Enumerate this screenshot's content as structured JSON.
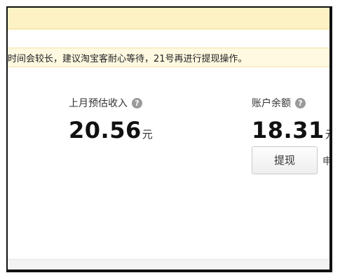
{
  "notice": {
    "text": "时间会较长，建议淘宝客耐心等待，21号再进行提现操作。"
  },
  "stats": {
    "last_month": {
      "label": "上月预估收入",
      "value": "20.56",
      "unit": "元",
      "help_icon": "question-circle-icon"
    },
    "balance": {
      "label": "账户余额",
      "value": "18.31",
      "unit": "元",
      "help_icon": "question-circle-icon"
    }
  },
  "actions": {
    "withdraw_label": "提现",
    "side_text": "申"
  },
  "colors": {
    "top_bar": "#fdf2c4",
    "notice_bg": "#fff9e1"
  }
}
